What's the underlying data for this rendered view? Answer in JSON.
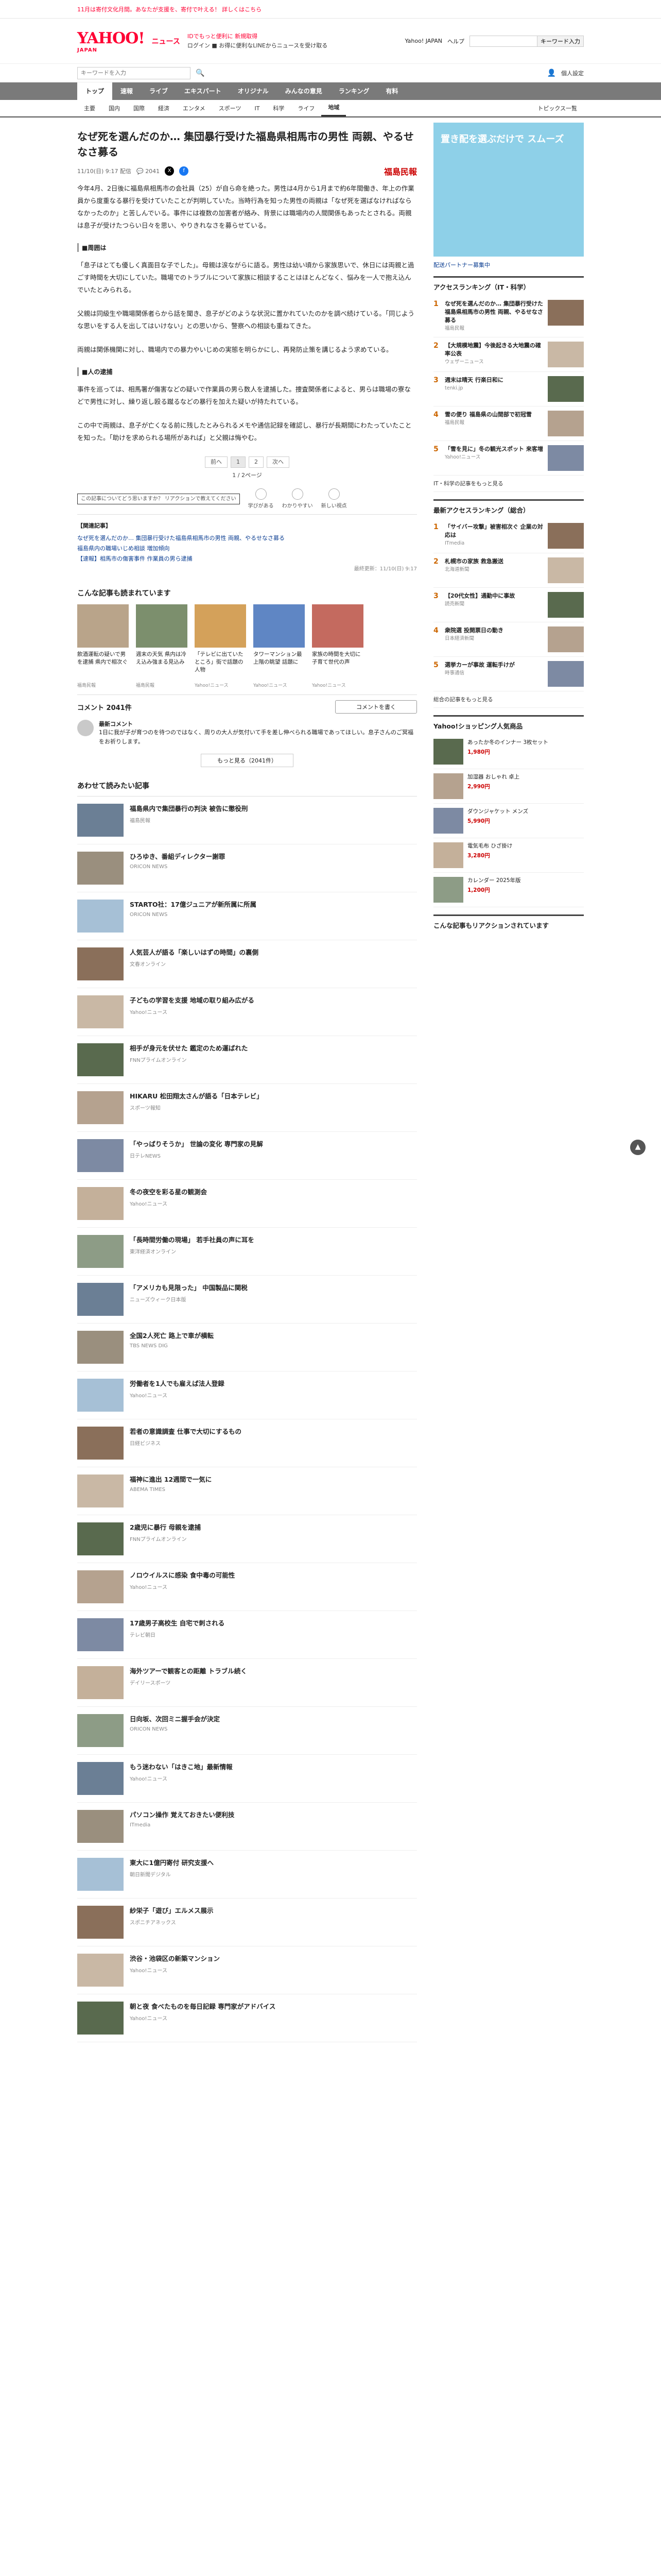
{
  "topbar": {
    "promo": "11月は寄付文化月間。あなたが支援を、寄付で叶える！ 詳しくはこちら"
  },
  "header": {
    "logo": "YAHOO!",
    "logo_sub": "JAPAN",
    "service": "ニュース",
    "line1": "IDでもっと便利に 新規取得",
    "line2": "ログイン ■ お得に便利なLINEからニュースを受け取る",
    "links": [
      "Yahoo! JAPAN",
      "ヘルプ"
    ],
    "search_placeholder": "",
    "search_button": "キーワード入力"
  },
  "subbar": {
    "search_placeholder": "キーワードを入力",
    "right": "個人設定"
  },
  "nav1": [
    "トップ",
    "速報",
    "ライブ",
    "エキスパート",
    "オリジナル",
    "みんなの意見",
    "ランキング",
    "有料"
  ],
  "nav2": [
    "主要",
    "国内",
    "国際",
    "経済",
    "エンタメ",
    "スポーツ",
    "IT",
    "科学",
    "ライフ",
    "地域"
  ],
  "nav2_right": "トピックス一覧",
  "article": {
    "title": "なぜ死を選んだのか… 集団暴行受けた福島県相馬市の男性 両親、やるせなさ募る",
    "date": "11/10(日) 9:17 配信",
    "comments_count": "2041",
    "brand": "福島民報",
    "paragraphs": [
      "今年4月、2日後に福島県相馬市の会社員（25）が自ら命を絶った。男性は4月から1月まで約6年間働き、年上の作業員から度重なる暴行を受けていたことが判明していた。当時行為を知った男性の両親は「なぜ死を選ばなければならなかったのか」と苦しんでいる。事件には複数の加害者が絡み、背景には職場内の人間関係もあったとされる。両親は息子が受けたつらい日々を思い、やりきれなさを募らせている。",
      "「息子はとても優しく真面目な子でした」。母親は涙ながらに語る。男性は幼い頃から家族思いで、休日には両親と過ごす時間を大切にしていた。職場でのトラブルについて家族に相談することはほとんどなく、悩みを一人で抱え込んでいたとみられる。",
      "父親は同級生や職場関係者らから話を聞き、息子がどのような状況に置かれていたのかを調べ続けている。「同じような思いをする人を出してはいけない」との思いから、警察への相談も重ねてきた。",
      "両親は関係機関に対し、職場内での暴力やいじめの実態を明らかにし、再発防止策を講じるよう求めている。"
    ],
    "section1": "■周囲は",
    "section2": "■人の逮捕",
    "paragraphs2": [
      "事件を巡っては、相馬署が傷害などの疑いで作業員の男ら数人を逮捕した。捜査関係者によると、男らは職場の寮などで男性に対し、繰り返し殴る蹴るなどの暴行を加えた疑いが持たれている。",
      "この中で両親は、息子が亡くなる前に残したとみられるメモや通信記録を確認し、暴行が長期間にわたっていたことを知った。「助けを求められる場所があれば」と父親は悔やむ。"
    ],
    "pager": {
      "prev": "前へ",
      "pages": [
        "1",
        "2"
      ],
      "next": "次へ",
      "count": "1 / 2ページ"
    },
    "reaction_tip": "この記事についてどう思いますか？ リアクションで教えてください",
    "reactions": [
      "学びがある",
      "わかりやすい",
      "新しい視点"
    ],
    "related_head": "【関連記事】",
    "related": [
      "なぜ死を選んだのか… 集団暴行受けた福島県相馬市の男性 両親、やるせなさ募る",
      "福島県内の職場いじめ相談 増加傾向",
      "【速報】相馬市の傷害事件 作業員の男ら逮捕"
    ],
    "footer_line": "最終更新：11/10(日) 9:17"
  },
  "recommend": {
    "title": "こんな記事も読まれています",
    "cards": [
      {
        "text": "飲酒運転の疑いで男を逮捕 県内で相次ぐ",
        "src": "福島民報"
      },
      {
        "text": "週末の天気 県内は冷え込み強まる見込み",
        "src": "福島民報"
      },
      {
        "text": "「テレビに出ていたところ」街で話題の人物",
        "src": "Yahoo!ニュース"
      },
      {
        "text": "タワーマンション最上階の眺望 話題に",
        "src": "Yahoo!ニュース"
      },
      {
        "text": "家族の時間を大切に 子育て世代の声",
        "src": "Yahoo!ニュース"
      }
    ]
  },
  "comments": {
    "title": "コメント 2041件",
    "button": "コメントを書く",
    "user": "最新コメント",
    "text": "1日に我が子が育つのを待つのではなく、周りの大人が気付いて手を差し伸べられる職場であってほしい。息子さんのご冥福をお祈りします。",
    "more": "もっと見る（2041件）"
  },
  "feed": {
    "title": "あわせて読みたい記事",
    "items": [
      {
        "text": "福島県内で集団暴行の判決 被告に懲役刑",
        "src": "福島民報"
      },
      {
        "text": "ひろゆき、番組ディレクター謝罪",
        "src": "ORICON NEWS"
      },
      {
        "text": "STARTO社：17億ジュニアが新所属に所属",
        "src": "ORICON NEWS"
      },
      {
        "text": "人気芸人が語る「楽しいはずの時間」の裏側",
        "src": "文春オンライン"
      },
      {
        "text": "子どもの学習を支援 地域の取り組み広がる",
        "src": "Yahoo!ニュース"
      },
      {
        "text": "相手が身元を伏せた 鑑定のため運ばれた",
        "src": "FNNプライムオンライン"
      },
      {
        "text": "HIKARU 松田翔太さんが語る「日本テレビ」",
        "src": "スポーツ報知"
      },
      {
        "text": "「やっばりそうか」 世論の変化 専門家の見解",
        "src": "日テレNEWS"
      },
      {
        "text": "冬の夜空を彩る星の観測会",
        "src": "Yahoo!ニュース"
      },
      {
        "text": "「長時間労働の現場」 若手社員の声に耳を",
        "src": "東洋経済オンライン"
      },
      {
        "text": "「アメリカも見限った」 中国製品に関税",
        "src": "ニューズウィーク日本版"
      },
      {
        "text": "全国2人死亡 路上で車が横転",
        "src": "TBS NEWS DIG"
      },
      {
        "text": "労働者を1人でも雇えば法人登録",
        "src": "Yahoo!ニュース"
      },
      {
        "text": "若者の意識調査 仕事で大切にするもの",
        "src": "日経ビジネス"
      },
      {
        "text": "福神に進出 12週間で一気に",
        "src": "ABEMA TIMES"
      },
      {
        "text": "2歳児に暴行 母親を逮捕",
        "src": "FNNプライムオンライン"
      },
      {
        "text": "ノロウイルスに感染 食中毒の可能性",
        "src": "Yahoo!ニュース"
      },
      {
        "text": "17歳男子高校生 自宅で刺される",
        "src": "テレビ朝日"
      },
      {
        "text": "海外ツアーで観客との距離 トラブル続く",
        "src": "デイリースポーツ"
      },
      {
        "text": "日向坂、次回ミニ握手会が決定",
        "src": "ORICON NEWS"
      },
      {
        "text": "もう迷わない「はきこ地」最新情報",
        "src": "Yahoo!ニュース"
      },
      {
        "text": "パソコン操作 覚えておきたい便利技",
        "src": "ITmedia"
      },
      {
        "text": "東大に1億円寄付 研究支援へ",
        "src": "朝日新聞デジタル"
      },
      {
        "text": "紗栄子「遊び」エルメス展示",
        "src": "スポニチアネックス"
      },
      {
        "text": "渋谷・池袋区の新築マンション",
        "src": "Yahoo!ニュース"
      },
      {
        "text": "朝と夜 食べたものを毎日記録 専門家がアドバイス",
        "src": "Yahoo!ニュース"
      }
    ]
  },
  "side": {
    "ad_text": "置き配を選ぶだけで スムーズ",
    "ad_caption": "配送パートナー募集中",
    "rank1_title": "アクセスランキング（IT・科学）",
    "rank1": [
      {
        "t": "なぜ死を選んだのか… 集団暴行受けた福島県相馬市の男性 両親、やるせなさ募る",
        "s": "福島民報"
      },
      {
        "t": "【大規模地震】今後起きる大地震の確率公表",
        "s": "ウェザーニュース"
      },
      {
        "t": "週末は晴天 行楽日和に",
        "s": "tenki.jp"
      },
      {
        "t": "雪の便り 福島県の山間部で初冠雪",
        "s": "福島民報"
      },
      {
        "t": "「雪を見に」冬の観光スポット 来客増",
        "s": "Yahoo!ニュース"
      }
    ],
    "more1": "IT・科学の記事をもっと見る",
    "rank2_title": "最新アクセスランキング（総合）",
    "rank2": [
      {
        "t": "「サイバー攻撃」被害相次ぐ 企業の対応は",
        "s": "ITmedia"
      },
      {
        "t": "札幌市の家族 救急搬送",
        "s": "北海道新聞"
      },
      {
        "t": "【20代女性】通勤中に事故",
        "s": "読売新聞"
      },
      {
        "t": "衆院選 投開票日の動き",
        "s": "日本経済新聞"
      },
      {
        "t": "選挙カーが事故 運転手けが",
        "s": "時事通信"
      }
    ],
    "more2": "総合の記事をもっと見る",
    "vp_title": "Yahoo!ショッピング人気商品",
    "vp": [
      {
        "t": "あったか冬のインナー 3枚セット",
        "p": "1,980円"
      },
      {
        "t": "加湿器 おしゃれ 卓上",
        "p": "2,990円"
      },
      {
        "t": "ダウンジャケット メンズ",
        "p": "5,990円"
      },
      {
        "t": "電気毛布 ひざ掛け",
        "p": "3,280円"
      },
      {
        "t": "カレンダー 2025年版",
        "p": "1,200円"
      }
    ],
    "rec_title": "こんな記事もリアクションされています"
  },
  "colors": {
    "brand_red": "#ff0033",
    "nav": "#7a7a7a"
  }
}
